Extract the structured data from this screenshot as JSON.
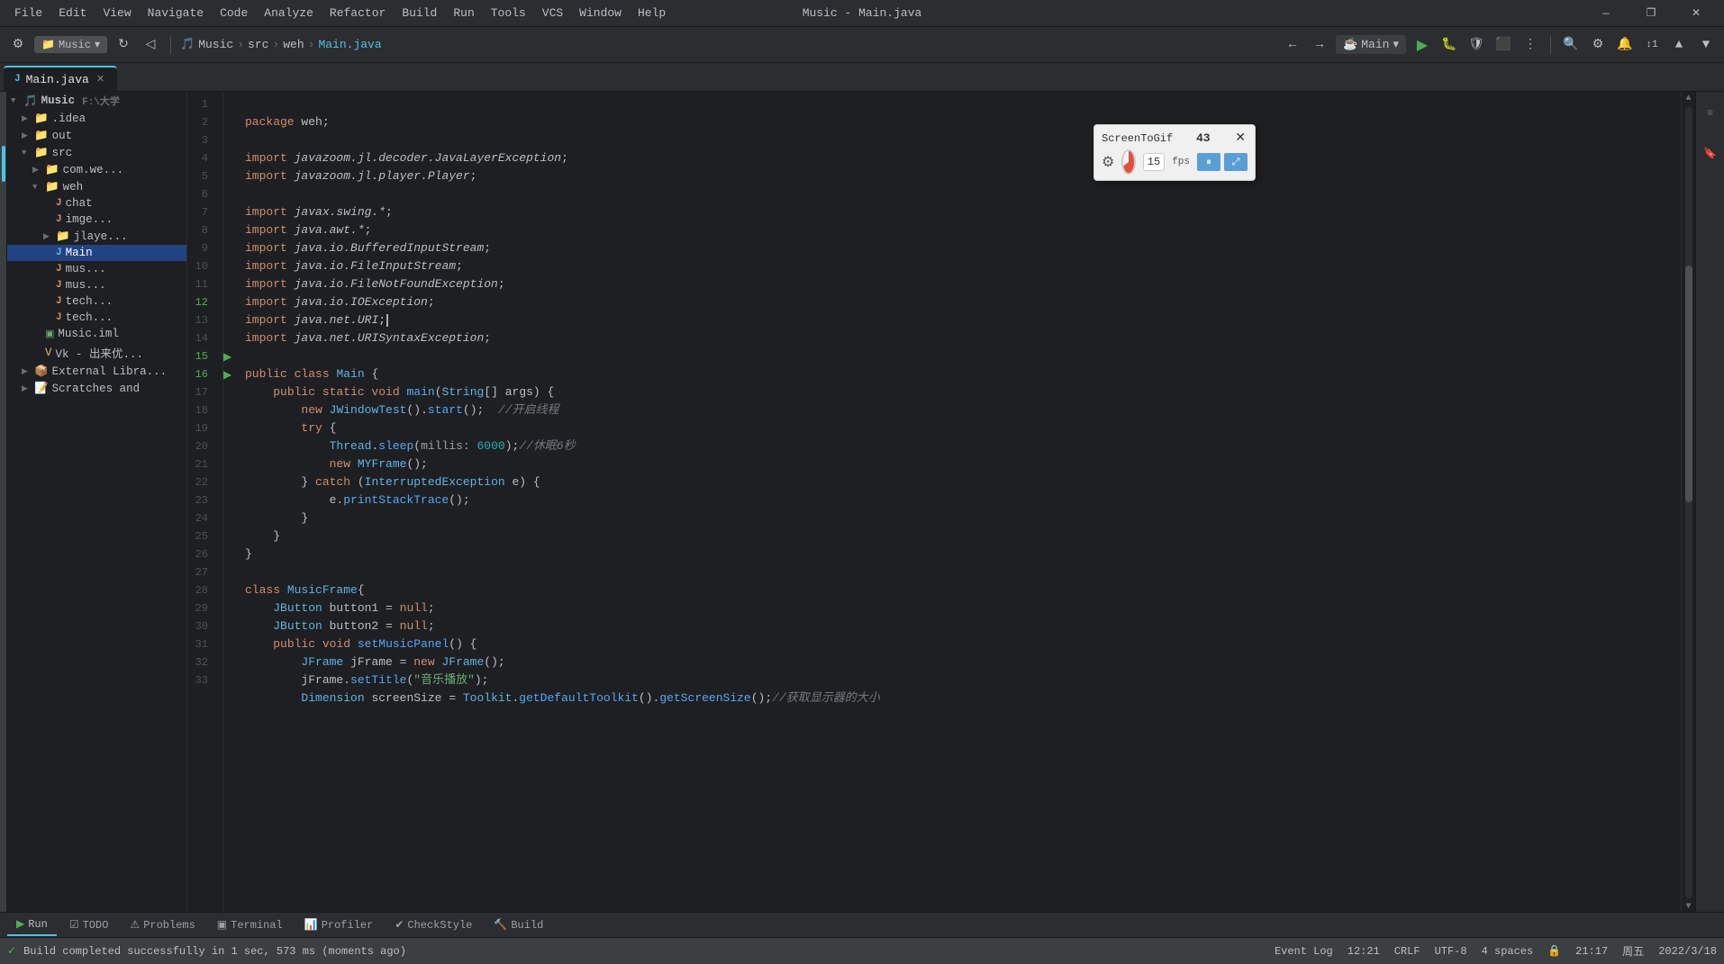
{
  "window": {
    "title": "Music - Main.java",
    "minimize": "—",
    "maximize": "❐",
    "close": "✕"
  },
  "menus": {
    "items": [
      "File",
      "Edit",
      "View",
      "Navigate",
      "Code",
      "Analyze",
      "Refactor",
      "Build",
      "Run",
      "Tools",
      "VCS",
      "Window",
      "Help"
    ]
  },
  "toolbar": {
    "project_label": "Music",
    "src_label": "src",
    "weh_label": "weh",
    "file_label": "Main.java",
    "run_config": "Main",
    "run_btn": "▶",
    "line_count": "1"
  },
  "tabs": {
    "items": [
      {
        "label": "Main.java",
        "active": true,
        "icon": "☕"
      }
    ]
  },
  "project_tree": {
    "root": "Music",
    "root_path": "F:\\大学",
    "items": [
      {
        "label": ".idea",
        "indent": 1,
        "type": "folder",
        "expanded": false
      },
      {
        "label": "out",
        "indent": 1,
        "type": "folder",
        "expanded": false
      },
      {
        "label": "src",
        "indent": 1,
        "type": "folder",
        "expanded": true
      },
      {
        "label": "com.we...",
        "indent": 2,
        "type": "folder",
        "expanded": false
      },
      {
        "label": "weh",
        "indent": 2,
        "type": "folder",
        "expanded": true
      },
      {
        "label": "chat",
        "indent": 3,
        "type": "file-java"
      },
      {
        "label": "imge...",
        "indent": 3,
        "type": "file-java"
      },
      {
        "label": "jlaye...",
        "indent": 3,
        "type": "folder",
        "expanded": false
      },
      {
        "label": "Main",
        "indent": 3,
        "type": "file-java",
        "selected": true
      },
      {
        "label": "mus...",
        "indent": 3,
        "type": "file-java"
      },
      {
        "label": "mus...",
        "indent": 3,
        "type": "file-java"
      },
      {
        "label": "tech...",
        "indent": 3,
        "type": "file-java"
      },
      {
        "label": "tech...",
        "indent": 3,
        "type": "file-java"
      },
      {
        "label": "Music.iml",
        "indent": 2,
        "type": "file"
      },
      {
        "label": "Vk - 出来优...",
        "indent": 2,
        "type": "file"
      },
      {
        "label": "External Libra...",
        "indent": 1,
        "type": "folder",
        "expanded": false
      },
      {
        "label": "Scratches and",
        "indent": 1,
        "type": "folder",
        "expanded": false
      }
    ]
  },
  "code": {
    "lines": [
      {
        "num": 1,
        "content": "package weh;"
      },
      {
        "num": 2,
        "content": ""
      },
      {
        "num": 3,
        "content": "import javazoom.jl.decoder.JavaLayerException;"
      },
      {
        "num": 4,
        "content": "import javazoom.jl.player.Player;"
      },
      {
        "num": 5,
        "content": ""
      },
      {
        "num": 6,
        "content": "import javax.swing.*;"
      },
      {
        "num": 7,
        "content": "import java.awt.*;"
      },
      {
        "num": 8,
        "content": "import java.io.BufferedInputStream;"
      },
      {
        "num": 9,
        "content": "import java.io.FileInputStream;"
      },
      {
        "num": 10,
        "content": "import java.io.FileNotFoundException;"
      },
      {
        "num": 11,
        "content": "import java.io.IOException;"
      },
      {
        "num": 12,
        "content": "import java.net.URI;"
      },
      {
        "num": 13,
        "content": "import java.net.URISyntaxException;"
      },
      {
        "num": 14,
        "content": ""
      },
      {
        "num": 15,
        "content": "public class Main {",
        "runnable": true
      },
      {
        "num": 16,
        "content": "    public static void main(String[] args) {",
        "runnable": true
      },
      {
        "num": 17,
        "content": "        new JWindowTest().start();  //开启线程"
      },
      {
        "num": 18,
        "content": "        try {"
      },
      {
        "num": 19,
        "content": "            Thread.sleep( millis: 6000);//休眠6秒"
      },
      {
        "num": 20,
        "content": "            new MYFrame();"
      },
      {
        "num": 21,
        "content": "        } catch (InterruptedException e) {"
      },
      {
        "num": 22,
        "content": "            e.printStackTrace();"
      },
      {
        "num": 23,
        "content": "        }"
      },
      {
        "num": 24,
        "content": "    }"
      },
      {
        "num": 25,
        "content": "}"
      },
      {
        "num": 26,
        "content": ""
      },
      {
        "num": 27,
        "content": "class MusicFrame{"
      },
      {
        "num": 28,
        "content": "    JButton button1 = null;"
      },
      {
        "num": 29,
        "content": "    JButton button2 = null;"
      },
      {
        "num": 30,
        "content": "    public void setMusicPanel() {"
      },
      {
        "num": 31,
        "content": "        JFrame jFrame = new JFrame();"
      },
      {
        "num": 32,
        "content": "        jFrame.setTitle(\"音乐播放\");"
      },
      {
        "num": 33,
        "content": "        Dimension screenSize = Toolkit.getDefaultToolkit().getScreenSize();//获取显示器的大小"
      }
    ]
  },
  "bottom_tabs": [
    {
      "label": "Run",
      "icon": "▶",
      "active": false
    },
    {
      "label": "TODO",
      "icon": "☑",
      "active": false
    },
    {
      "label": "Problems",
      "icon": "⚠",
      "active": false
    },
    {
      "label": "Terminal",
      "icon": "▣",
      "active": false
    },
    {
      "label": "Profiler",
      "icon": "📊",
      "active": false
    },
    {
      "label": "CheckStyle",
      "icon": "✔",
      "active": false
    },
    {
      "label": "Build",
      "icon": "🔨",
      "active": false
    }
  ],
  "status_bar": {
    "build_status": "Build completed successfully in 1 sec, 573 ms (moments ago)",
    "event_log": "Event Log",
    "time": "21:17",
    "day": "周五",
    "date": "2022/3/18",
    "encoding": "UTF-8",
    "line_sep": "CRLF",
    "indent": "4 spaces",
    "line_col": "12:21"
  },
  "screentogif": {
    "title": "ScreenToGif",
    "count": "43",
    "fps_value": "15",
    "fps_label": "fps"
  }
}
